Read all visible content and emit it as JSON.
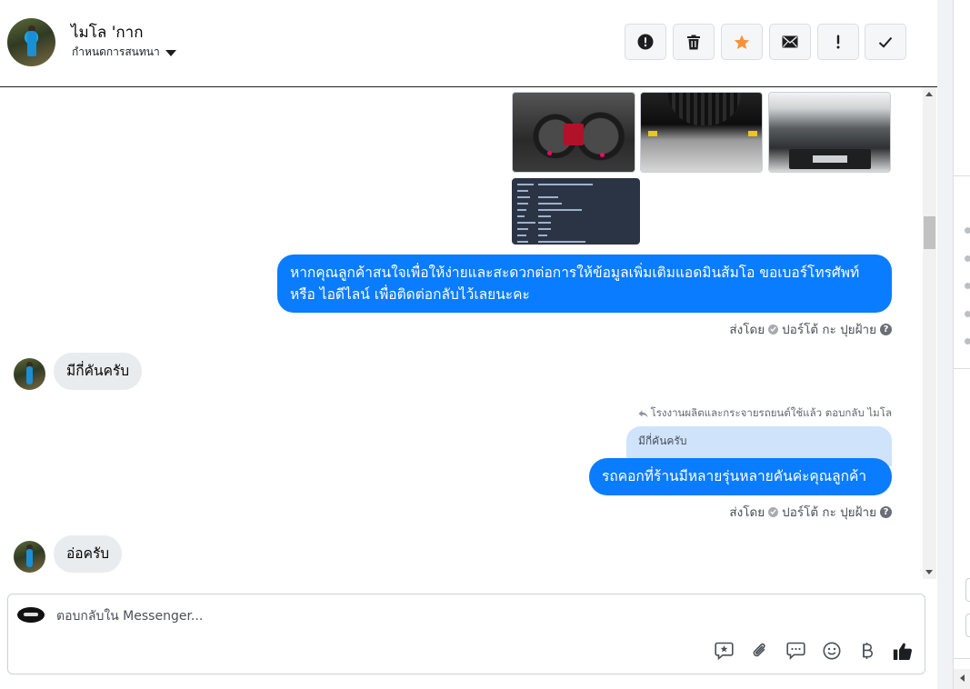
{
  "header": {
    "contact_name": "ไมโล 'กาก",
    "settings_label": "กำหนดการสนทนา"
  },
  "toolbar": [
    {
      "name": "report-spam-button",
      "icon": "exclamation-circle-icon"
    },
    {
      "name": "delete-button",
      "icon": "trash-icon"
    },
    {
      "name": "star-button",
      "icon": "star-icon",
      "color": "#f7923b"
    },
    {
      "name": "mark-unread-button",
      "icon": "envelope-icon"
    },
    {
      "name": "follow-up-button",
      "icon": "exclamation-icon"
    },
    {
      "name": "mark-done-button",
      "icon": "checkmark-icon"
    }
  ],
  "messages": {
    "outgoing_1": "หากคุณลูกค้าสนใจเพื่อให้ง่ายและสะดวกต่อการให้ข้อมูลเพิ่มเติมแอดมินส้มโอ ขอเบอร์โทรศัพท์ หรือ ไอดีไลน์ เพื่อติดต่อกลับไว้เลยนะคะ",
    "sent_by_prefix": "ส่งโดย",
    "sent_by_name": "ปอร์โต้ กะ ปุยฝ้าย",
    "incoming_1": "มีกี่คันครับ",
    "reply_meta": "โรงงานผลิตและกระจายรถยนต์ใช้แล้ว ตอบกลับ ไมโล",
    "reply_quote": "มีกี่คันครับ",
    "outgoing_2": "รถคอกที่ร้านมีหลายรุ่นหลายคันค่ะคุณลูกค้า",
    "incoming_2": "อ่อครับ"
  },
  "attachments": [
    "dashboard-photo",
    "undercarriage-photo",
    "engine-bay-photo",
    "spec-sheet-image"
  ],
  "composer": {
    "placeholder": "ตอบกลับใน Messenger...",
    "tools": [
      "saved-reply-icon",
      "attachment-icon",
      "chat-bubble-icon",
      "emoji-icon",
      "baht-icon",
      "thumbs-up-icon"
    ]
  },
  "colors": {
    "outgoing_bubble": "#0a7cff",
    "incoming_bubble": "#e9ecef",
    "reply_quote_bg": "#cfe3fb",
    "accent_star": "#f7923b"
  }
}
